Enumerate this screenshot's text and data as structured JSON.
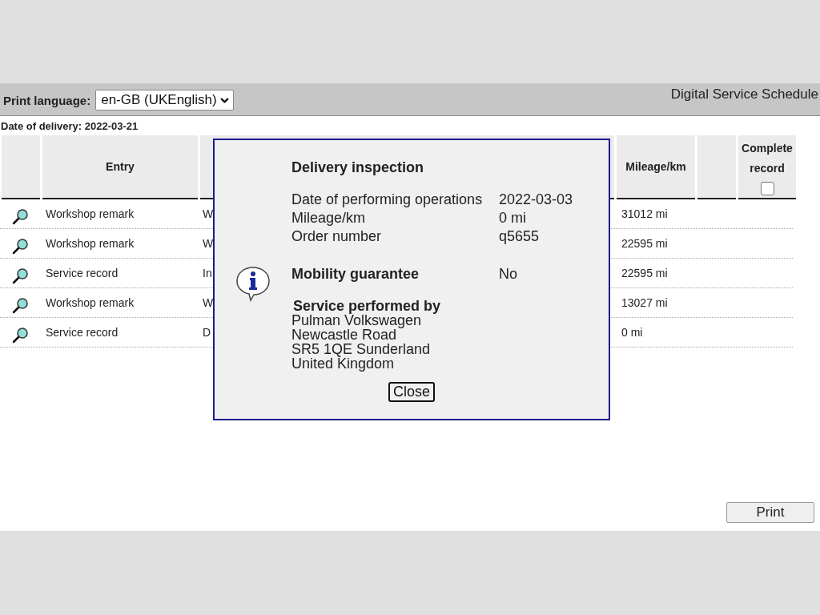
{
  "toolbar": {
    "print_language_label": "Print language:",
    "language": "en-GB (UKEnglish)",
    "title": "Digital Service Schedule"
  },
  "delivery_date": "Date of delivery: 2022-03-21",
  "table": {
    "columns": {
      "entry": "Entry",
      "mileage": "Mileage/km",
      "complete_record": {
        "label": "Complete record",
        "checked": false
      }
    },
    "rows": [
      {
        "entry": "Workshop remark",
        "column_3": "W",
        "mileage": "31012 mi"
      },
      {
        "entry": "Workshop remark",
        "column_3": "W",
        "mileage": "22595 mi"
      },
      {
        "entry": "Service record",
        "column_3": "In",
        "mileage": "22595 mi"
      },
      {
        "entry": "Workshop remark",
        "column_3": "W",
        "mileage": "13027 mi"
      },
      {
        "entry": "Service record",
        "column_3": "D",
        "mileage": "0 mi"
      }
    ]
  },
  "dialog": {
    "title": "Delivery inspection",
    "fields": [
      {
        "label": "Date of performing operations",
        "value": "2022-03-03"
      },
      {
        "label": "Mileage/km",
        "value": "0 mi"
      },
      {
        "label": "Order number",
        "value": "q5655"
      }
    ],
    "mobility": {
      "label": "Mobility guarantee",
      "value": "No"
    },
    "service_heading": "Service performed by",
    "address": [
      "Pulman Volkswagen",
      "Newcastle Road",
      "SR5 1QE Sunderland",
      "United Kingdom"
    ],
    "close": "Close"
  },
  "print_button": "Print"
}
